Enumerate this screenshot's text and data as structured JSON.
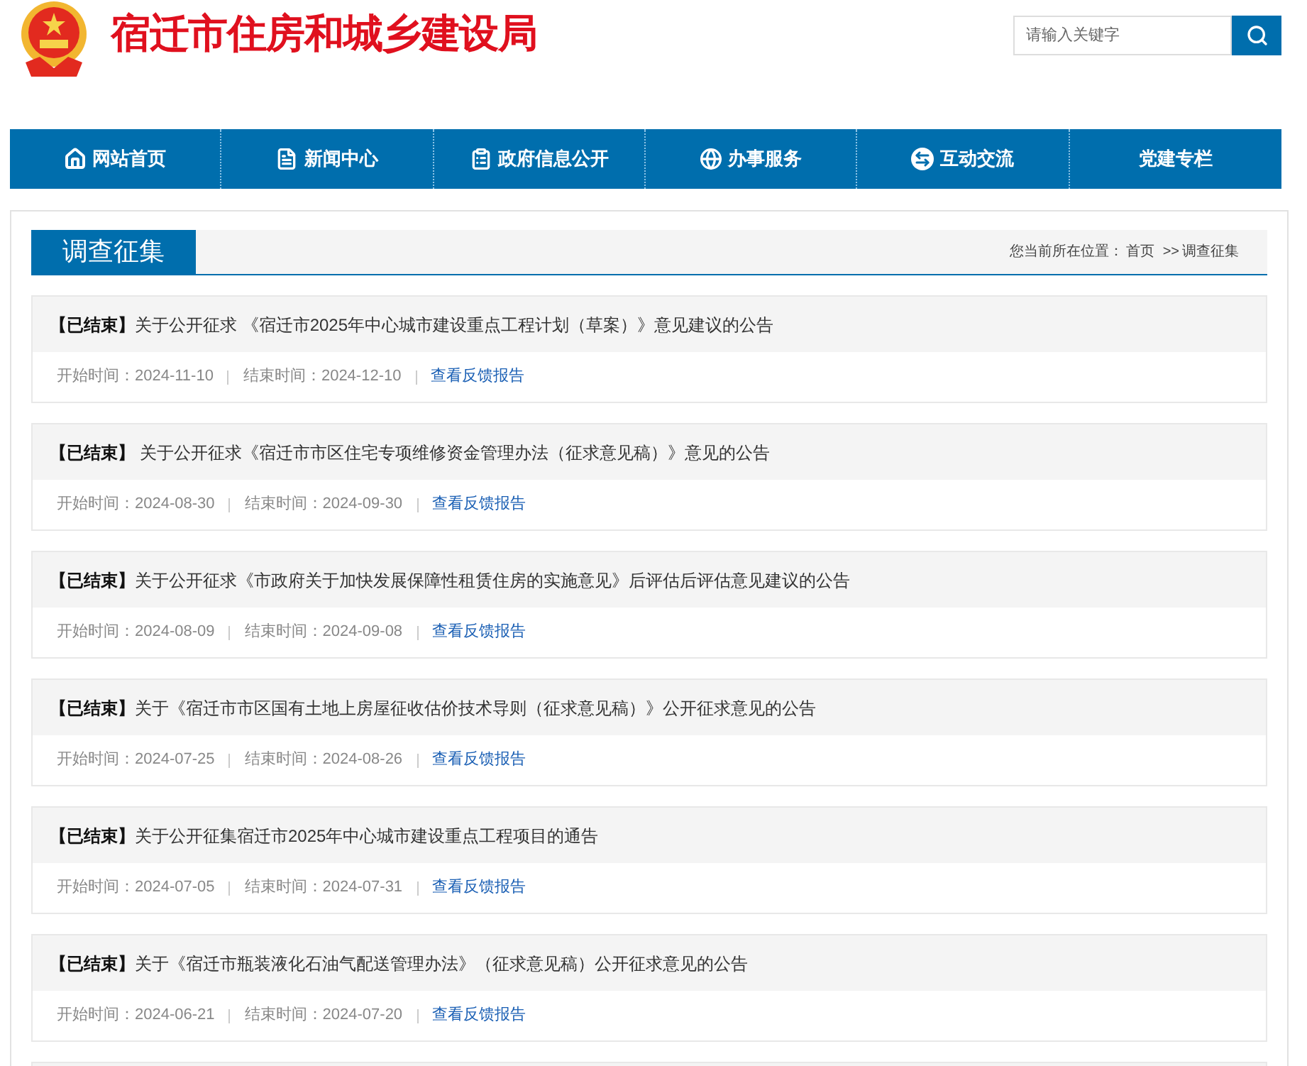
{
  "header": {
    "title": "宿迁市住房和城乡建设局",
    "search": {
      "placeholder": "请输入关键字"
    }
  },
  "nav": [
    {
      "label": "网站首页",
      "kind": "home"
    },
    {
      "label": "新闻中心",
      "kind": "news"
    },
    {
      "label": "政府信息公开",
      "kind": "info"
    },
    {
      "label": "办事服务",
      "kind": "service"
    },
    {
      "label": "互动交流",
      "kind": "interact"
    },
    {
      "label": "党建专栏",
      "kind": "party"
    }
  ],
  "section": {
    "title": "调查征集",
    "breadcrumb": [
      {
        "text": "您当前所在位置：",
        "kind": "label"
      },
      {
        "text": "首页",
        "kind": "link"
      },
      {
        "text": ">>",
        "kind": "separator"
      },
      {
        "text": "调查征集",
        "kind": "link"
      }
    ]
  },
  "items": [
    {
      "status": "【已结束】",
      "title": "关于公开征求 《宿迁市2025年中心城市建设重点工程计划（草案）》意见建议的公告",
      "start": "开始时间：2024-11-10",
      "end": "结束时间：2024-12-10",
      "link": "查看反馈报告"
    },
    {
      "status": "【已结束】",
      "title": " 关于公开征求《宿迁市市区住宅专项维修资金管理办法（征求意见稿）》意见的公告",
      "start": "开始时间：2024-08-30",
      "end": "结束时间：2024-09-30",
      "link": "查看反馈报告"
    },
    {
      "status": "【已结束】",
      "title": "关于公开征求《市政府关于加快发展保障性租赁住房的实施意见》后评估后评估意见建议的公告",
      "start": "开始时间：2024-08-09",
      "end": "结束时间：2024-09-08",
      "link": "查看反馈报告"
    },
    {
      "status": "【已结束】",
      "title": "关于《宿迁市市区国有土地上房屋征收估价技术导则（征求意见稿）》公开征求意见的公告",
      "start": "开始时间：2024-07-25",
      "end": "结束时间：2024-08-26",
      "link": "查看反馈报告"
    },
    {
      "status": "【已结束】",
      "title": "关于公开征集宿迁市2025年中心城市建设重点工程项目的通告",
      "start": "开始时间：2024-07-05",
      "end": "结束时间：2024-07-31",
      "link": "查看反馈报告"
    },
    {
      "status": "【已结束】",
      "title": "关于《宿迁市瓶装液化石油气配送管理办法》（征求意见稿）公开征求意见的公告",
      "start": "开始时间：2024-06-21",
      "end": "结束时间：2024-07-20",
      "link": "查看反馈报告"
    }
  ]
}
